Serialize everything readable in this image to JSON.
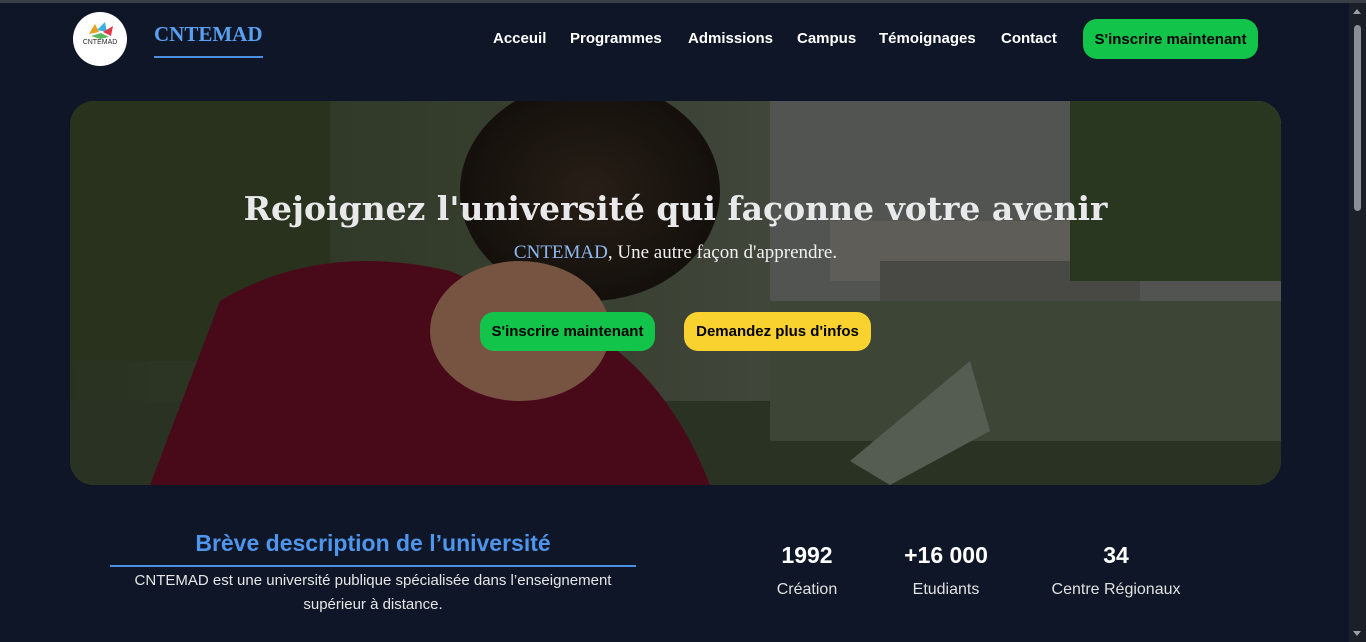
{
  "header": {
    "logo_text": "CNTEMAD",
    "brand": "CNTEMAD",
    "nav": [
      "Acceuil",
      "Programmes",
      "Admissions",
      "Campus",
      "Témoignages",
      "Contact"
    ],
    "cta": "S'inscrire maintenant"
  },
  "hero": {
    "title": "Rejoignez l'université qui façonne votre avenir",
    "subtitle_brand": "CNTEMAD",
    "subtitle_rest": ", Une autre façon d'apprendre.",
    "primary_button": "S'inscrire maintenant",
    "secondary_button": "Demandez plus d'infos"
  },
  "about": {
    "title": "Brève description de l’université",
    "text": "CNTEMAD est une université publique spécialisée dans l’enseignement supérieur à distance."
  },
  "stats": [
    {
      "value": "1992",
      "label": "Création"
    },
    {
      "value": "+16 000",
      "label": "Etudiants"
    },
    {
      "value": "34",
      "label": "Centre Régionaux"
    }
  ],
  "colors": {
    "background": "#0f1627",
    "accent_blue": "#4e95ec",
    "green": "#13c44a",
    "yellow": "#f9d230"
  }
}
